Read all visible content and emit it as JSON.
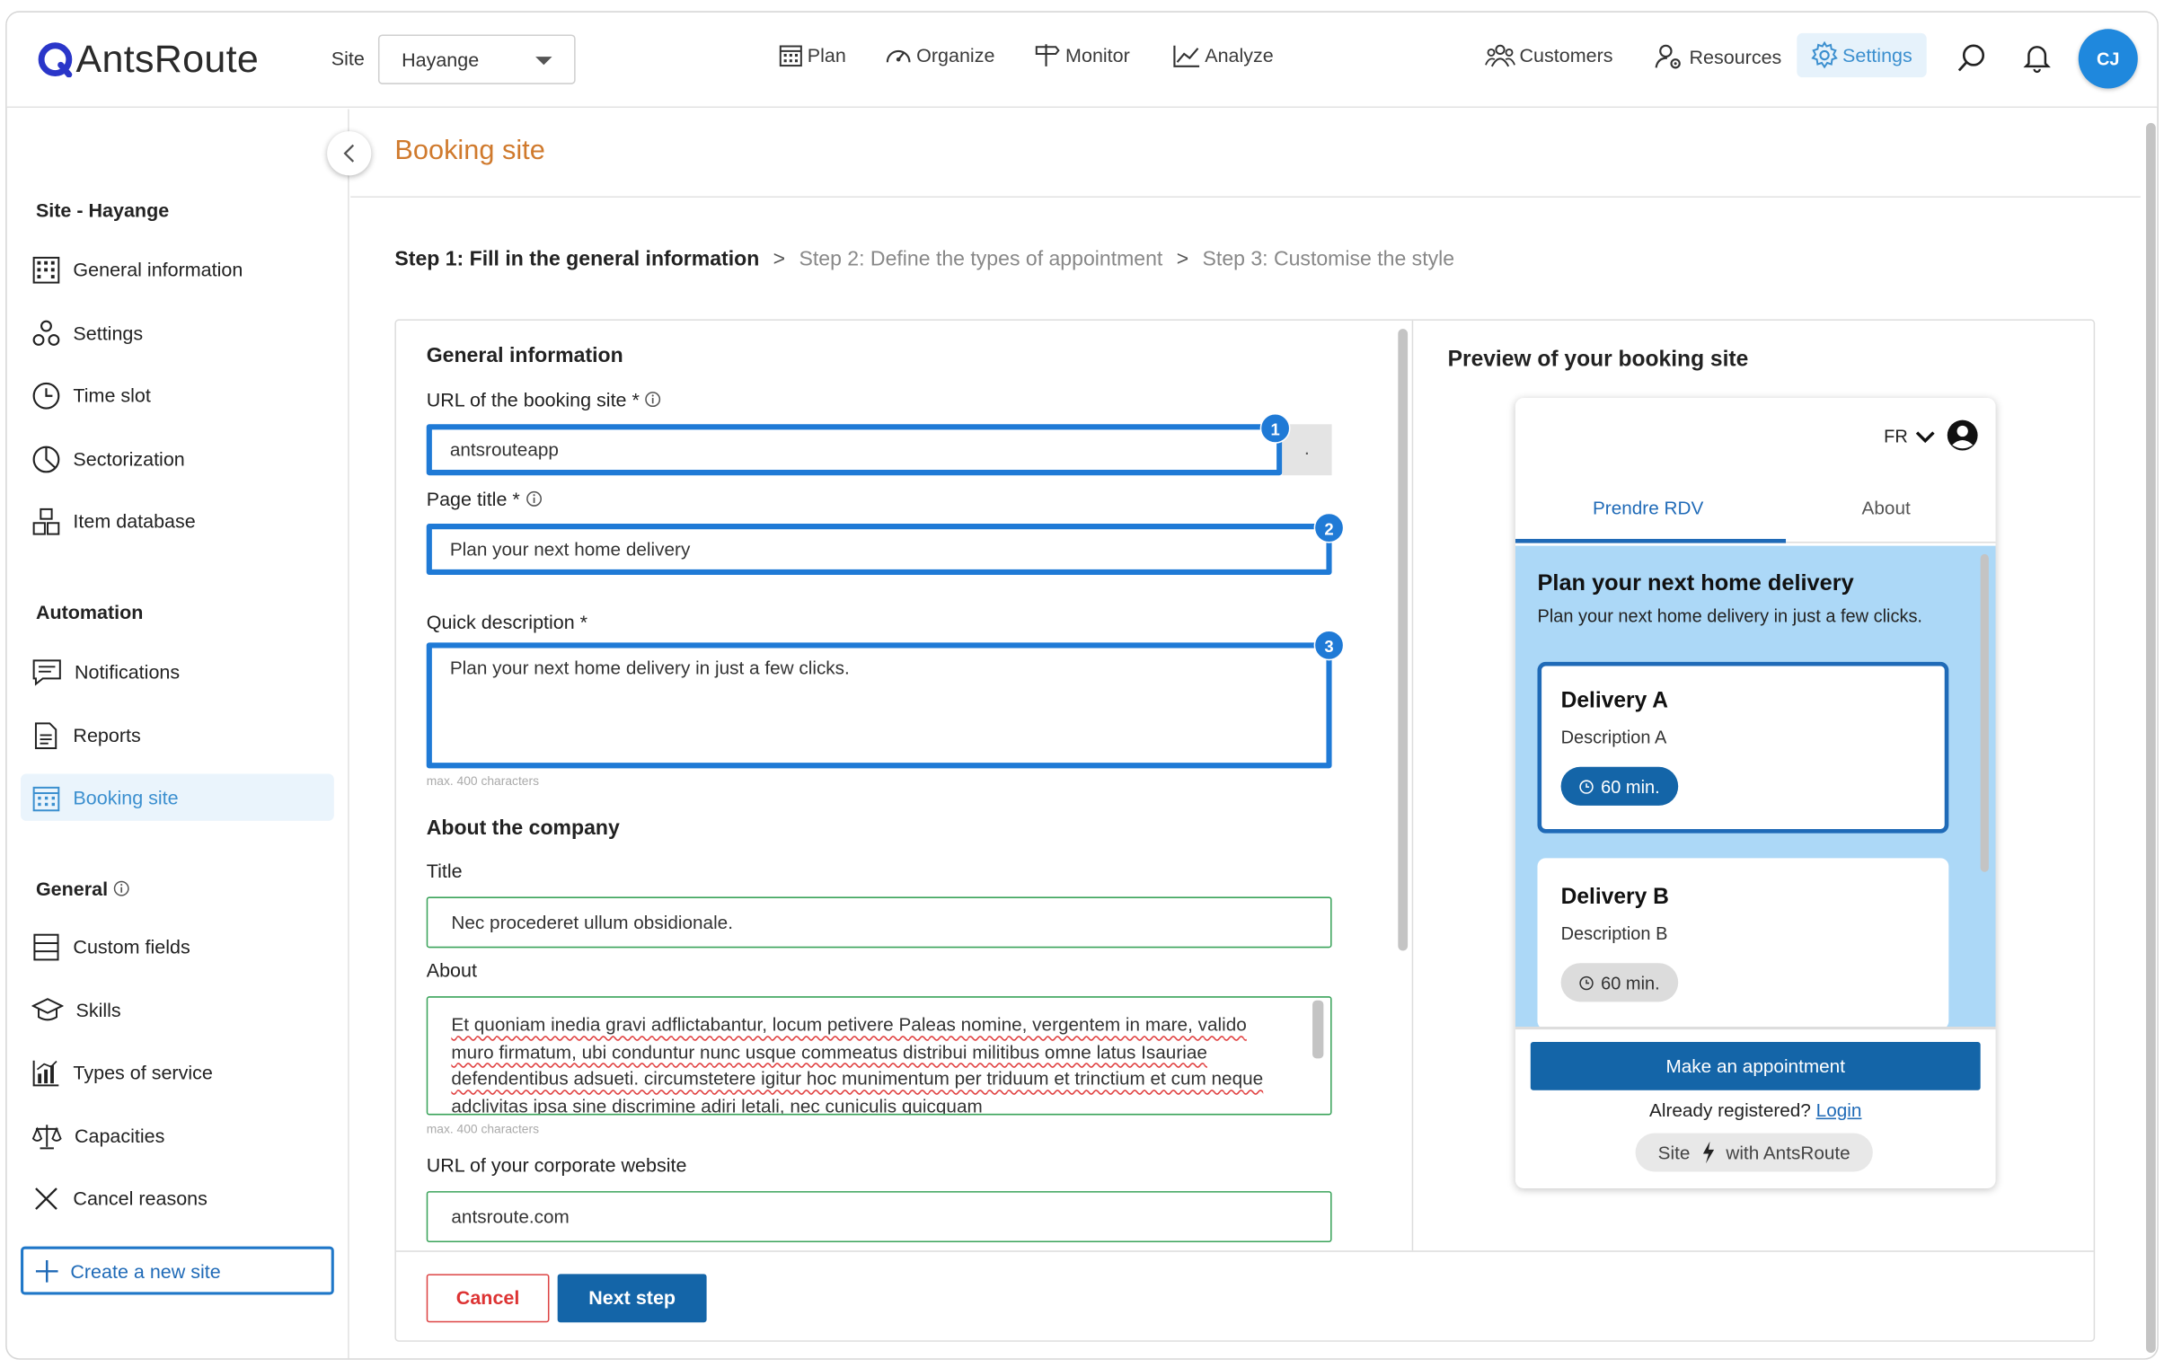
{
  "app": {
    "logo_text": "AntsRoute",
    "user_initials": "CJ"
  },
  "topbar": {
    "site_label": "Site",
    "site_value": "Hayange",
    "nav": {
      "plan": "Plan",
      "organize": "Organize",
      "monitor": "Monitor",
      "analyze": "Analyze"
    },
    "right": {
      "customers": "Customers",
      "resources": "Resources",
      "settings": "Settings"
    }
  },
  "sidebar": {
    "site_section": "Site - Hayange",
    "site_items": [
      "General information",
      "Settings",
      "Time slot",
      "Sectorization",
      "Item database"
    ],
    "automation_section": "Automation",
    "automation_items": [
      "Notifications",
      "Reports",
      "Booking site"
    ],
    "general_section": "General",
    "general_items": [
      "Custom fields",
      "Skills",
      "Types of service",
      "Capacities",
      "Cancel reasons"
    ],
    "create_button": "Create a new site"
  },
  "main": {
    "page_title": "Booking site",
    "steps": {
      "step1": "Step 1: Fill in the general information",
      "step2": "Step 2: Define the types of appointment",
      "step3": "Step 3: Customise the style",
      "separator": ">"
    },
    "form": {
      "general_heading": "General information",
      "url_label": "URL of the booking site *",
      "url_value": "antsrouteapp",
      "url_suffix": ".",
      "page_title_label": "Page title *",
      "page_title_value": "Plan your next home delivery",
      "quick_desc_label": "Quick description *",
      "quick_desc_value": "Plan your next home delivery in just a few clicks.",
      "max_chars": "max. 400 characters",
      "company_heading": "About the company",
      "title_label": "Title",
      "title_value": "Nec procederet ullum obsidionale.",
      "about_label": "About",
      "about_value": "Et quoniam inedia gravi adflictabantur, locum petivere Paleas nomine, vergentem in mare, valido muro firmatum, ubi conduntur nunc usque commeatus distribui militibus omne latus Isauriae defendentibus adsueti. circumstetere igitur hoc munimentum per triduum et trinctium et cum neque adclivitas ipsa sine discrimine adiri letali, nec cuniculis quicquam",
      "website_label": "URL of your corporate website",
      "website_value": "antsroute.com",
      "badges": [
        "1",
        "2",
        "3"
      ]
    },
    "buttons": {
      "cancel": "Cancel",
      "next": "Next step"
    }
  },
  "preview": {
    "heading": "Preview of your booking site",
    "lang": "FR",
    "tabs": [
      "Prendre RDV",
      "About"
    ],
    "title": "Plan your next home delivery",
    "subtitle": "Plan your next home delivery in just a few clicks.",
    "cards": [
      {
        "title": "Delivery A",
        "desc": "Description A",
        "duration": "60 min."
      },
      {
        "title": "Delivery B",
        "desc": "Description B",
        "duration": "60 min."
      }
    ],
    "make_button": "Make an appointment",
    "already": "Already registered?",
    "login": "Login",
    "powered_site": "Site",
    "powered_with": "with AntsRoute"
  },
  "colors": {
    "accent": "#1f7ad6",
    "primary_button": "#1465a8",
    "page_title": "#d07a2d",
    "cancel": "#dd3333",
    "valid_border": "#3aa35a",
    "preview_bg": "#acd8f7"
  }
}
